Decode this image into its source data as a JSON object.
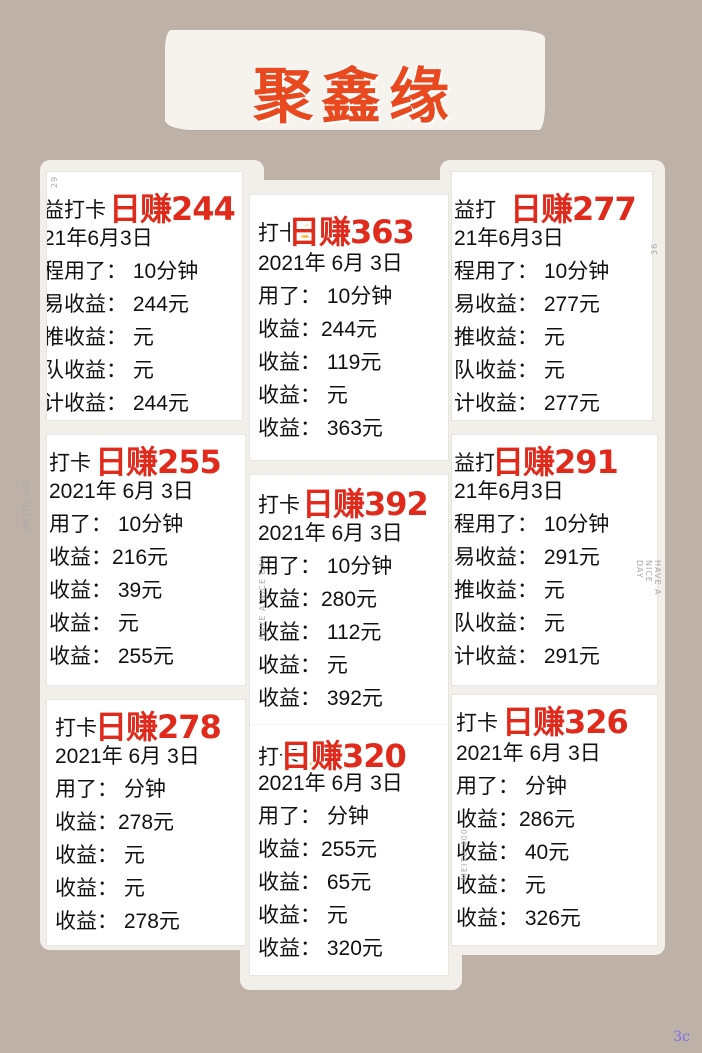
{
  "title": "聚鑫缘",
  "watermark": "3c",
  "side_texts": {
    "meitu": "MEITU 400",
    "nice_day": "HAVE A NICE DAY",
    "n29": "29",
    "n36": "36"
  },
  "cards": [
    {
      "stamp": "日赚244",
      "prefix": "益打卡",
      "lines": [
        "21年6月3日",
        "程用了：  10分钟",
        "易收益：  244元",
        "推收益：  元",
        "队收益：  元",
        "计收益：  244元"
      ]
    },
    {
      "stamp": "日赚363",
      "prefix": "打卡",
      "lines": [
        "2021年 6月 3日",
        "用了：  10分钟",
        "收益：244元",
        "收益：  119元",
        "收益：  元",
        "收益：  363元"
      ]
    },
    {
      "stamp": "日赚277",
      "prefix": "益打",
      "lines": [
        "21年6月3日",
        "程用了：  10分钟",
        "易收益：  277元",
        "推收益：  元",
        "队收益：  元",
        "计收益：  277元"
      ]
    },
    {
      "stamp": "日赚255",
      "prefix": "打卡",
      "lines": [
        "2021年 6月 3日",
        "用了：  10分钟",
        "收益：216元",
        "收益：  39元",
        "收益：  元",
        "收益：  255元"
      ]
    },
    {
      "stamp": "日赚392",
      "prefix": "打卡",
      "lines": [
        "2021年 6月 3日",
        "用了：  10分钟",
        "收益：280元",
        "收益：  112元",
        "收益：  元",
        "收益：  392元"
      ]
    },
    {
      "stamp": "日赚291",
      "prefix": "益打",
      "lines": [
        "21年6月3日",
        "程用了：  10分钟",
        "易收益：  291元",
        "推收益：  元",
        "队收益：  元",
        "计收益：  291元"
      ]
    },
    {
      "stamp": "日赚278",
      "prefix": "打卡",
      "lines": [
        "2021年 6月 3日",
        "用了：  分钟",
        "收益：278元",
        "收益：  元",
        "收益：  元",
        "收益：  278元"
      ]
    },
    {
      "stamp": "日赚320",
      "prefix": "打卡",
      "lines": [
        "2021年 6月 3日",
        "用了：  分钟",
        "收益：255元",
        "收益：  65元",
        "收益：  元",
        "收益：  320元"
      ]
    },
    {
      "stamp": "日赚326",
      "prefix": "打卡",
      "lines": [
        "2021年 6月 3日",
        "用了：  分钟",
        "收益：286元",
        "收益：  40元",
        "收益：  元",
        "收益：  326元"
      ]
    }
  ]
}
